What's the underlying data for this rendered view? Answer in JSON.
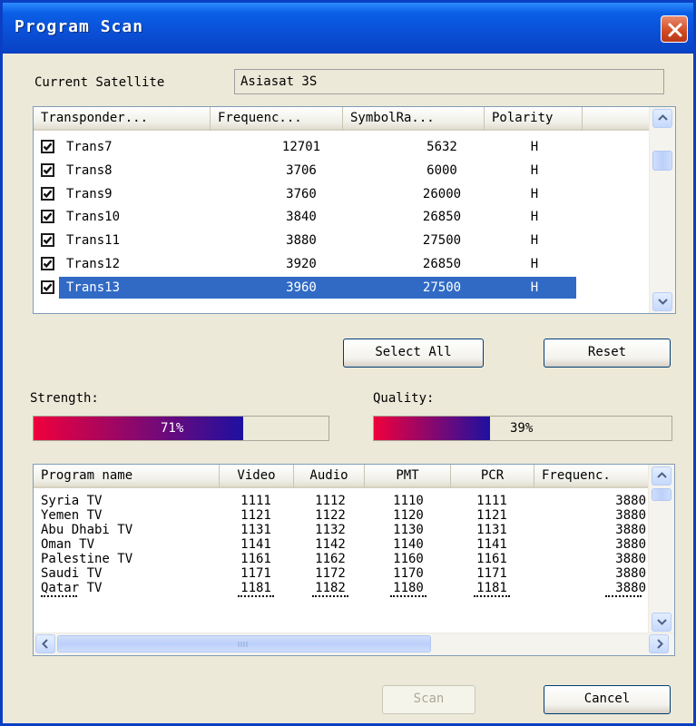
{
  "window": {
    "title": "Program Scan"
  },
  "satellite": {
    "label": "Current Satellite",
    "value": "Asiasat 3S"
  },
  "transponders": {
    "columns": [
      "Transponder...",
      "Frequenc...",
      "SymbolRa...",
      "Polarity"
    ],
    "rows": [
      {
        "name": "Trans7",
        "frequency": "12701",
        "symbol_rate": "5632",
        "polarity": "H",
        "checked": true
      },
      {
        "name": "Trans8",
        "frequency": "3706",
        "symbol_rate": "6000",
        "polarity": "H",
        "checked": true
      },
      {
        "name": "Trans9",
        "frequency": "3760",
        "symbol_rate": "26000",
        "polarity": "H",
        "checked": true
      },
      {
        "name": "Trans10",
        "frequency": "3840",
        "symbol_rate": "26850",
        "polarity": "H",
        "checked": true
      },
      {
        "name": "Trans11",
        "frequency": "3880",
        "symbol_rate": "27500",
        "polarity": "H",
        "checked": true
      },
      {
        "name": "Trans12",
        "frequency": "3920",
        "symbol_rate": "26850",
        "polarity": "H",
        "checked": true
      },
      {
        "name": "Trans13",
        "frequency": "3960",
        "symbol_rate": "27500",
        "polarity": "H",
        "checked": true
      }
    ],
    "selected_row": "Trans13"
  },
  "buttons": {
    "select_all": "Select All",
    "reset": "Reset",
    "scan": "Scan",
    "cancel": "Cancel"
  },
  "signal": {
    "strength": {
      "label": "Strength:",
      "value_text": "71%",
      "fraction": 0.71
    },
    "quality": {
      "label": "Quality:",
      "value_text": "39%",
      "fraction": 0.39
    }
  },
  "programs": {
    "columns": [
      "Program name",
      "Video",
      "Audio",
      "PMT",
      "PCR",
      "Frequenc."
    ],
    "rows": [
      {
        "name": "Syria TV",
        "video": "1111",
        "audio": "1112",
        "pmt": "1110",
        "pcr": "1111",
        "frequency": "3880"
      },
      {
        "name": "Yemen TV",
        "video": "1121",
        "audio": "1122",
        "pmt": "1120",
        "pcr": "1121",
        "frequency": "3880"
      },
      {
        "name": "Abu Dhabi TV",
        "video": "1131",
        "audio": "1132",
        "pmt": "1130",
        "pcr": "1131",
        "frequency": "3880"
      },
      {
        "name": "Oman TV",
        "video": "1141",
        "audio": "1142",
        "pmt": "1140",
        "pcr": "1141",
        "frequency": "3880"
      },
      {
        "name": "Palestine TV",
        "video": "1161",
        "audio": "1162",
        "pmt": "1160",
        "pcr": "1161",
        "frequency": "3880"
      },
      {
        "name": "Saudi TV",
        "video": "1171",
        "audio": "1172",
        "pmt": "1170",
        "pcr": "1171",
        "frequency": "3880"
      },
      {
        "name": "Qatar TV",
        "video": "1181",
        "audio": "1182",
        "pmt": "1180",
        "pcr": "1181",
        "frequency": "3880"
      }
    ]
  },
  "colors": {
    "title_bar": "#0A4FD6",
    "selection": "#316AC5",
    "progress_start": "#F0003C",
    "progress_end": "#1E10A0"
  }
}
